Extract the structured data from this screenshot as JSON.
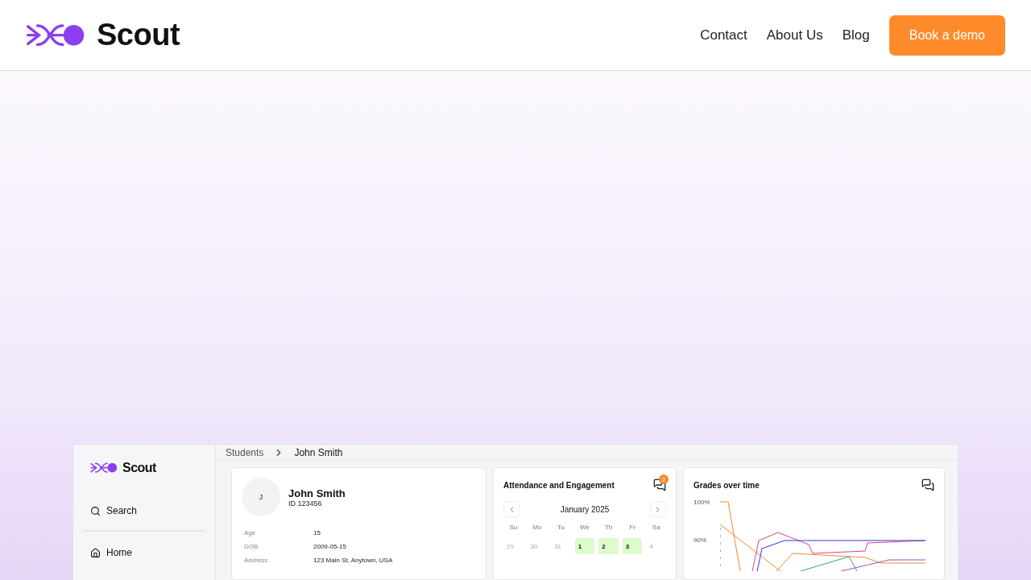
{
  "header": {
    "brand": "Scout",
    "nav": [
      {
        "label": "Contact"
      },
      {
        "label": "About Us"
      },
      {
        "label": "Blog"
      }
    ],
    "cta": "Book a demo"
  },
  "app": {
    "brand": "Scout",
    "sidebar": [
      {
        "label": "Search",
        "kind": "search"
      },
      {
        "label": "Home",
        "kind": "home"
      }
    ],
    "breadcrumb": [
      "Students",
      "John Smith"
    ],
    "profile": {
      "initial": "J",
      "name": "John Smith",
      "id": "ID 123456",
      "fields": [
        {
          "label": "Age",
          "value": "15"
        },
        {
          "label": "DOB",
          "value": "2009-05-15"
        },
        {
          "label": "Address",
          "value": "123 Main St, Anytown, USA"
        }
      ]
    },
    "attendance": {
      "title": "Attendance and Engagement",
      "badge": "2",
      "month": "January 2025",
      "weekdays": [
        "Su",
        "Mo",
        "Tu",
        "We",
        "Th",
        "Fr",
        "Sa"
      ],
      "days": [
        {
          "label": "29",
          "kind": "muted"
        },
        {
          "label": "30",
          "kind": "muted"
        },
        {
          "label": "31",
          "kind": "muted"
        },
        {
          "label": "1",
          "kind": "present"
        },
        {
          "label": "2",
          "kind": "present"
        },
        {
          "label": "3",
          "kind": "present"
        },
        {
          "label": "4",
          "kind": "muted"
        }
      ]
    },
    "grades": {
      "title": "Grades over time",
      "y_labels": [
        "100%",
        "90%"
      ]
    }
  }
}
